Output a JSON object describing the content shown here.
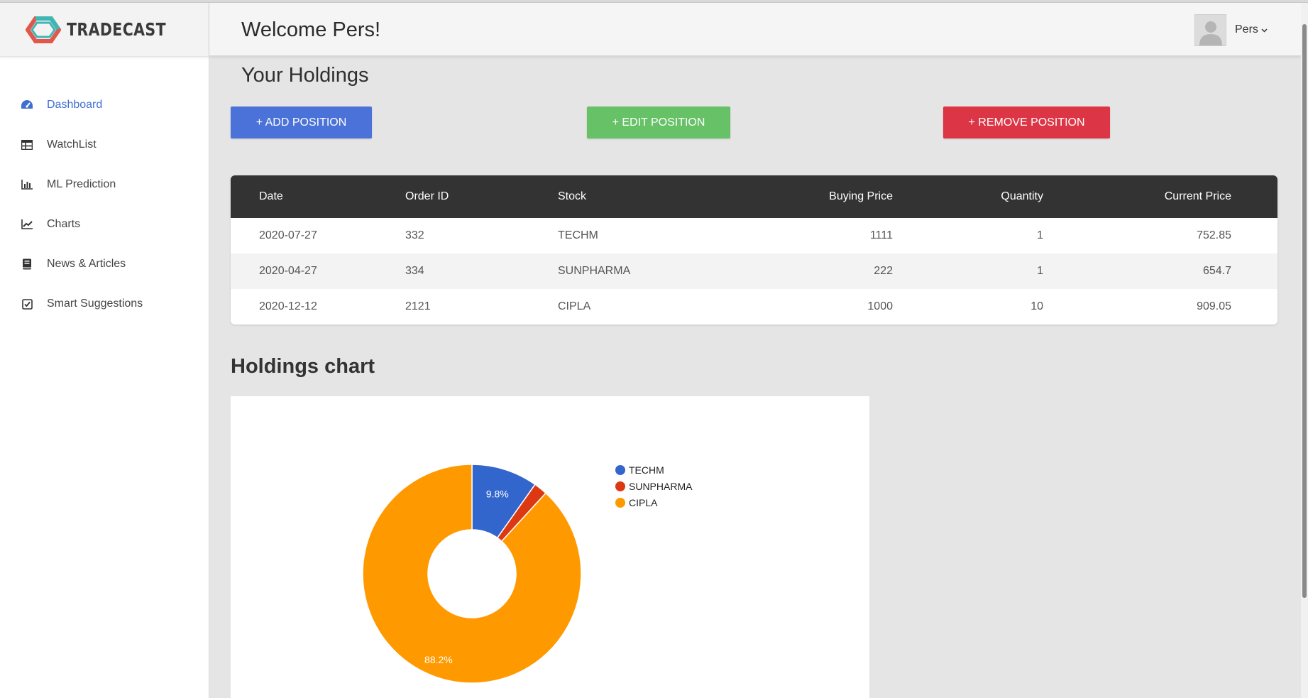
{
  "app": {
    "name": "TRADECAST"
  },
  "sidebar": {
    "items": [
      {
        "label": "Dashboard",
        "icon": "dashboard-gauge-icon",
        "active": true
      },
      {
        "label": "WatchList",
        "icon": "table-icon",
        "active": false
      },
      {
        "label": "ML Prediction",
        "icon": "bar-chart-icon",
        "active": false
      },
      {
        "label": "Charts",
        "icon": "line-chart-icon",
        "active": false
      },
      {
        "label": "News & Articles",
        "icon": "book-icon",
        "active": false
      },
      {
        "label": "Smart Suggestions",
        "icon": "checkbox-icon",
        "active": false
      }
    ]
  },
  "header": {
    "welcome": "Welcome Pers!",
    "user": "Pers"
  },
  "holdings": {
    "title": "Your Holdings",
    "buttons": {
      "add": "+ ADD POSITION",
      "edit": "+ EDIT POSITION",
      "remove": "+ REMOVE POSITION"
    },
    "columns": [
      "Date",
      "Order ID",
      "Stock",
      "Buying Price",
      "Quantity",
      "Current Price"
    ],
    "rows": [
      [
        "2020-07-27",
        "332",
        "TECHM",
        "1111",
        "1",
        "752.85"
      ],
      [
        "2020-04-27",
        "334",
        "SUNPHARMA",
        "222",
        "1",
        "654.7"
      ],
      [
        "2020-12-12",
        "2121",
        "CIPLA",
        "1000",
        "10",
        "909.05"
      ]
    ]
  },
  "chart_section": {
    "title": "Holdings chart"
  },
  "colors": {
    "primary": "#4a72d8",
    "success": "#66c167",
    "danger": "#dc3545",
    "header_dark": "#333333"
  },
  "chart_data": {
    "type": "pie",
    "donut": true,
    "legend": "right",
    "categories": [
      "TECHM",
      "SUNPHARMA",
      "CIPLA"
    ],
    "values": [
      9.8,
      2.0,
      88.2
    ],
    "value_labels": [
      "9.8%",
      "",
      "88.2%"
    ],
    "colors": [
      "#3366cc",
      "#dc3912",
      "#ff9900"
    ]
  }
}
